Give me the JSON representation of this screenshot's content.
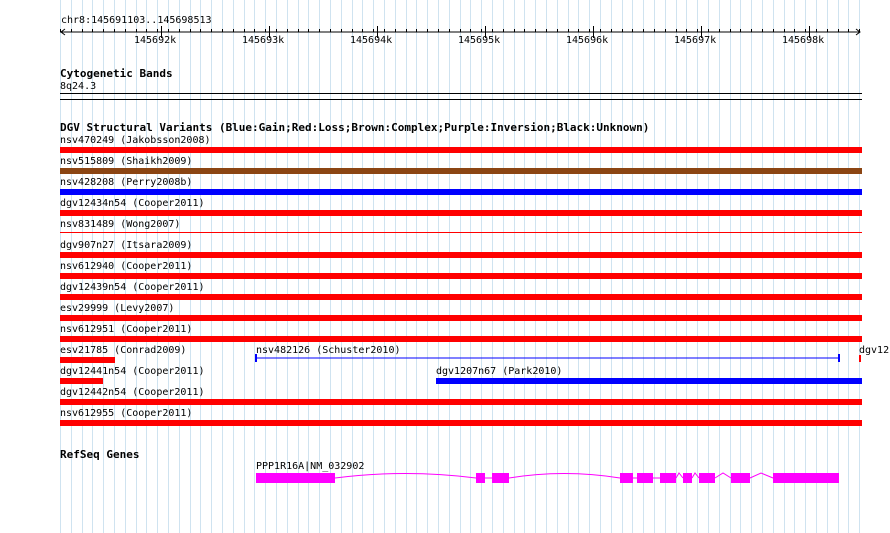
{
  "location": "chr8:145691103..145698513",
  "ruler_ticks": [
    "145692k",
    "145693k",
    "145694k",
    "145695k",
    "145696k",
    "145697k",
    "145698k"
  ],
  "tracks": {
    "cytoband": {
      "title": "Cytogenetic Bands",
      "band": "8q24.3"
    },
    "dgv": {
      "title": "DGV Structural Variants (Blue:Gain;Red:Loss;Brown:Complex;Purple:Inversion;Black:Unknown)",
      "colors": {
        "gain": "#0000ff",
        "loss": "#ff0000",
        "complex": "#8b4513",
        "inversion": "#800080",
        "unknown": "#000000"
      },
      "variants": [
        {
          "label": "nsv470249 (Jakobsson2008)",
          "type": "loss"
        },
        {
          "label": "nsv515809 (Shaikh2009)",
          "type": "complex"
        },
        {
          "label": "nsv428208 (Perry2008b)",
          "type": "gain"
        },
        {
          "label": "dgv12434n54 (Cooper2011)",
          "type": "loss"
        },
        {
          "label": "nsv831489 (Wong2007)",
          "type": "loss"
        },
        {
          "label": "dgv907n27 (Itsara2009)",
          "type": "loss"
        },
        {
          "label": "nsv612940 (Cooper2011)",
          "type": "loss"
        },
        {
          "label": "dgv12439n54 (Cooper2011)",
          "type": "loss"
        },
        {
          "label": "esv29999 (Levy2007)",
          "type": "loss"
        },
        {
          "label": "nsv612951 (Cooper2011)",
          "type": "loss"
        },
        {
          "label": "esv21785 (Conrad2009)",
          "type": "loss"
        },
        {
          "label": "nsv482126 (Schuster2010)",
          "type": "gain"
        },
        {
          "label": "dgv12",
          "type": "loss"
        },
        {
          "label": "dgv12441n54 (Cooper2011)",
          "type": "loss"
        },
        {
          "label": "dgv1207n67 (Park2010)",
          "type": "gain"
        },
        {
          "label": "dgv12442n54 (Cooper2011)",
          "type": "loss"
        },
        {
          "label": "nsv612955 (Cooper2011)",
          "type": "loss"
        }
      ]
    },
    "refseq": {
      "title": "RefSeq Genes",
      "gene_label": "PPP1R16A|NM_032902",
      "color": "#ff00ff"
    }
  }
}
